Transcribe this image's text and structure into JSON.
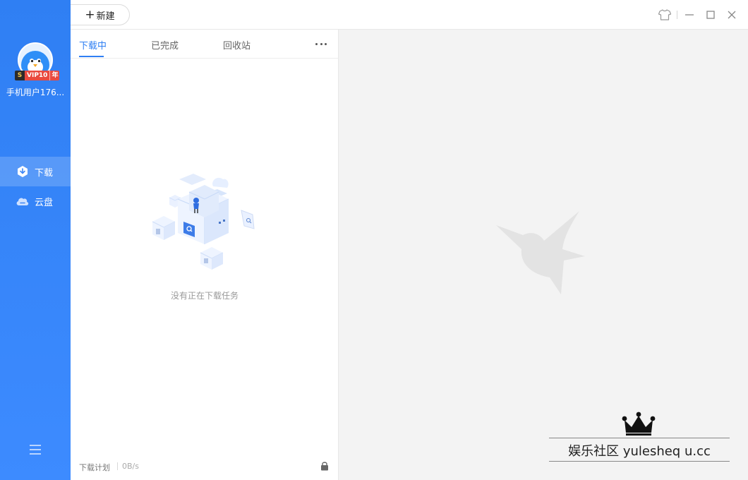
{
  "sidebar": {
    "username": "手机用户176...",
    "vip": {
      "s": "S",
      "label": "VIP10",
      "year": "年"
    },
    "nav": [
      {
        "label": "下载",
        "icon": "download-icon",
        "active": true
      },
      {
        "label": "云盘",
        "icon": "cloud-icon",
        "active": false
      }
    ],
    "menu_icon": "hamburger-menu-icon"
  },
  "topbar": {
    "new_button": "新建",
    "controls": [
      "skin-icon",
      "minimize-icon",
      "maximize-icon",
      "close-icon"
    ]
  },
  "panel": {
    "tabs": [
      {
        "label": "下载中",
        "active": true
      },
      {
        "label": "已完成",
        "active": false
      },
      {
        "label": "回收站",
        "active": false
      }
    ],
    "empty_text": "没有正在下载任务",
    "footer": {
      "plan": "下载计划",
      "speed": "0B/s"
    }
  },
  "watermark": {
    "text": "娱乐社区 yulesheq u.cc"
  },
  "colors": {
    "accent": "#2f7ff3",
    "sidebar_top": "#2f7ff3",
    "sidebar_bottom": "#3d8bff",
    "background": "#f3f3f3"
  }
}
